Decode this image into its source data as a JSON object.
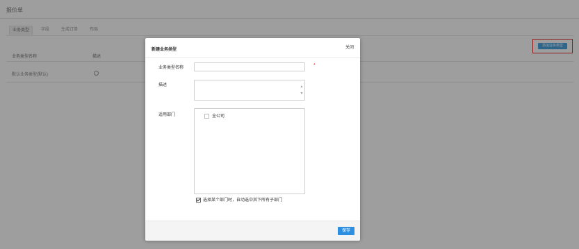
{
  "page": {
    "title": "报价单"
  },
  "tabs": [
    {
      "label": "业务类型"
    },
    {
      "label": "字段"
    },
    {
      "label": "生成订单"
    },
    {
      "label": "布局"
    }
  ],
  "add_button": {
    "label": "添加业务类型"
  },
  "table": {
    "headers": [
      "业务类型名称",
      "描述"
    ],
    "rows": [
      {
        "name": "默认业务类型(默认)"
      }
    ]
  },
  "modal": {
    "title": "新建业务类型",
    "close_label": "关闭",
    "fields": {
      "name_label": "业务类型名称",
      "required_mark": "*",
      "description_label": "描述",
      "departments_label": "适用部门"
    },
    "departments": [
      {
        "label": "全公司",
        "checked": false
      }
    ],
    "include_children": {
      "label": "选择某个部门时，自动选中其下所有子部门",
      "checked": true
    },
    "save_label": "保存"
  },
  "colors": {
    "accent": "#2e8ee0",
    "add_button_bg": "#4aa3e0",
    "highlight_border": "#e03030",
    "overlay": "rgba(0,0,0,0.38)"
  }
}
